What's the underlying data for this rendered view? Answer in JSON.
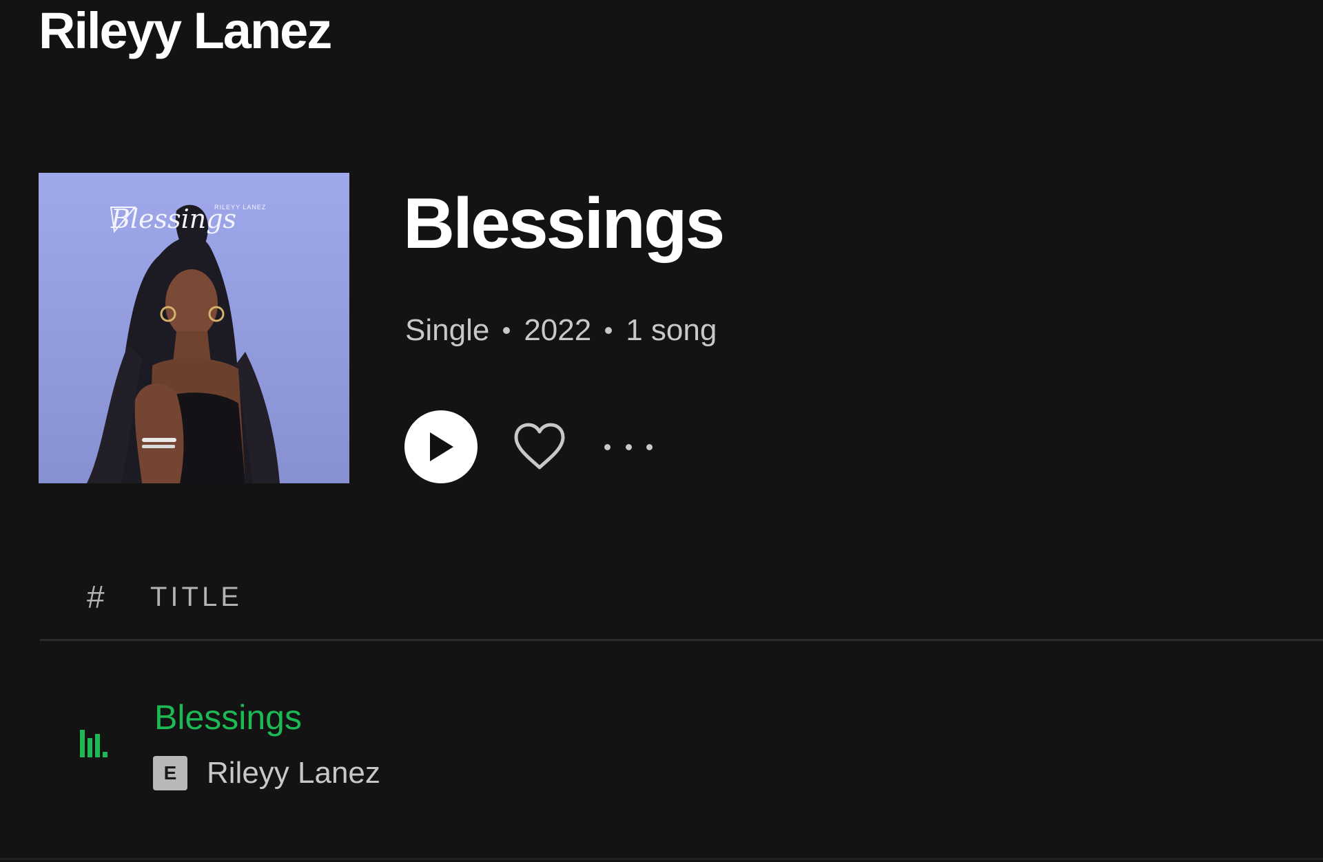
{
  "artist_header": {
    "name": "Rileyy Lanez"
  },
  "album": {
    "title": "Blessings",
    "type": "Single",
    "year": "2022",
    "song_count": "1 song",
    "cover_title_script": "Blessings",
    "cover_artist_text": "RILEYY LANEZ"
  },
  "actions": {
    "play": "play-icon",
    "like": "heart-icon",
    "more": "more-dots-icon"
  },
  "tracklist": {
    "header": {
      "number_label": "#",
      "title_label": "TITLE"
    },
    "tracks": [
      {
        "title": "Blessings",
        "explicit_badge": "E",
        "artist": "Rileyy Lanez",
        "playing_indicator": "equalizer-icon"
      }
    ]
  },
  "colors": {
    "background": "#131313",
    "accent_green": "#1db954",
    "secondary_text": "#c8c8c8"
  }
}
